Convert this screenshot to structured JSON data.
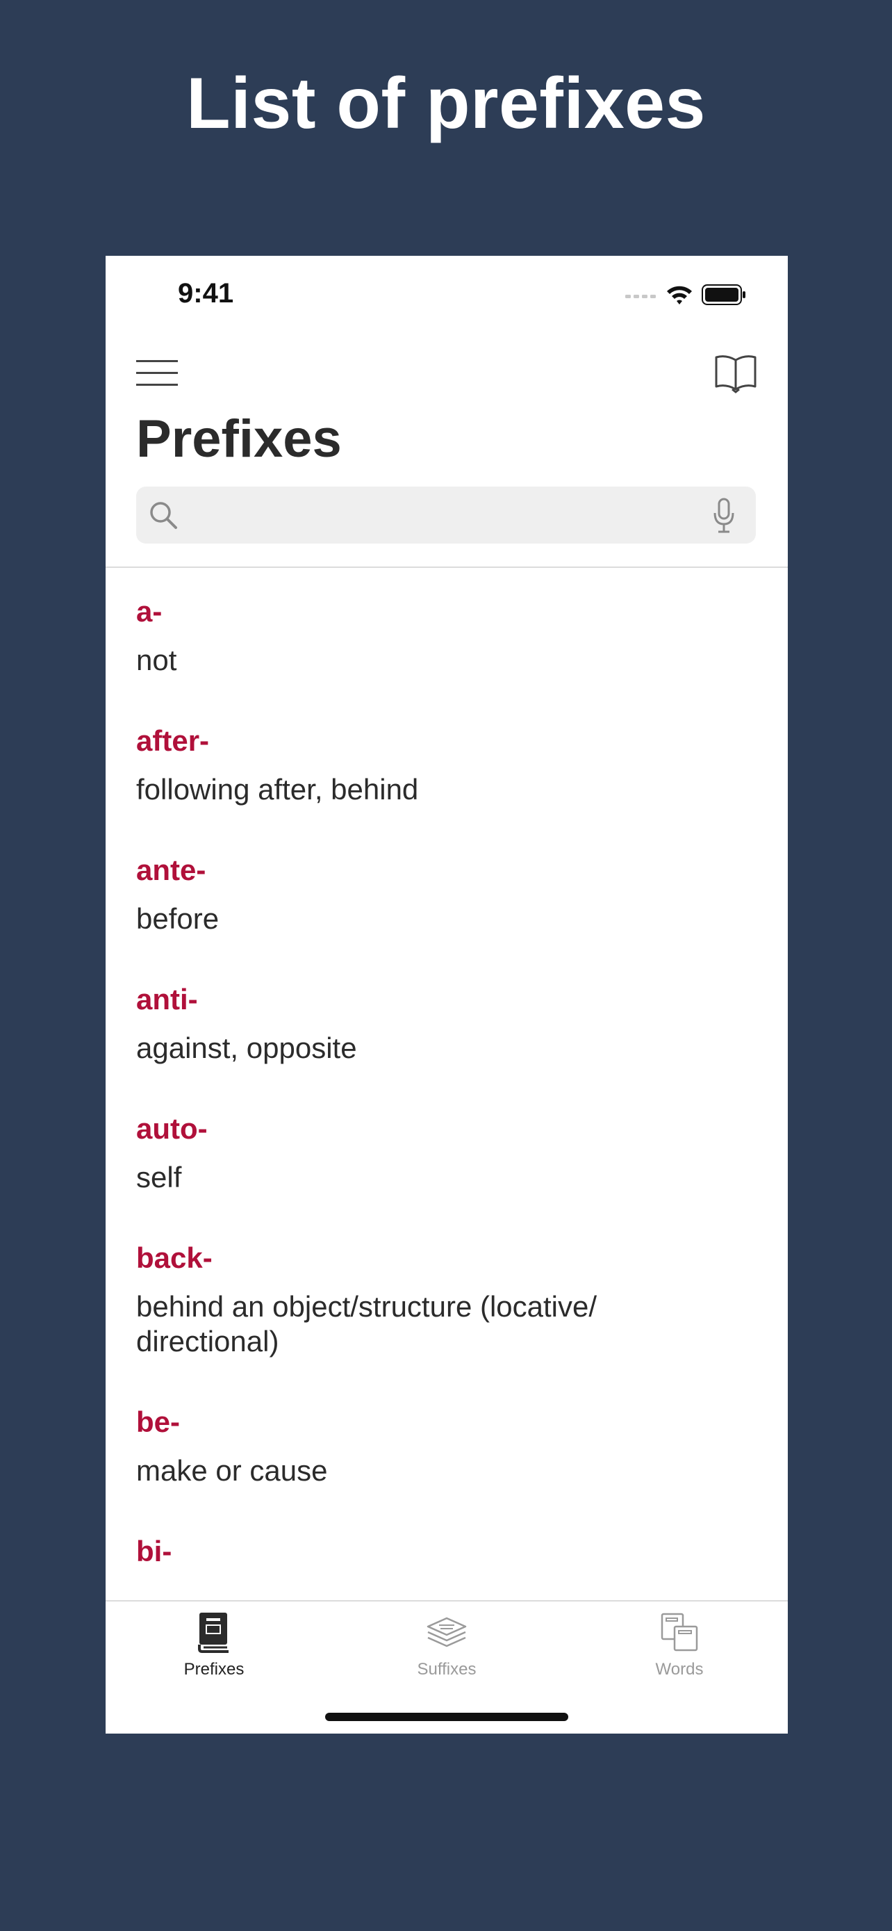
{
  "promo": {
    "title": "List of prefixes"
  },
  "status_bar": {
    "time": "9:41",
    "signal_icon": "cellular-signal-icon",
    "wifi_icon": "wifi-icon",
    "battery_icon": "battery-icon"
  },
  "header": {
    "menu_icon": "hamburger-menu-icon",
    "book_icon": "open-book-icon",
    "title": "Prefixes"
  },
  "search": {
    "placeholder": "",
    "value": "",
    "search_icon": "magnifier-icon",
    "mic_icon": "microphone-icon"
  },
  "list": {
    "items": [
      {
        "prefix": "a-",
        "meaning": "not"
      },
      {
        "prefix": "after-",
        "meaning": "following after, behind"
      },
      {
        "prefix": "ante-",
        "meaning": "before"
      },
      {
        "prefix": "anti-",
        "meaning": "against, opposite"
      },
      {
        "prefix": "auto-",
        "meaning": "self"
      },
      {
        "prefix": "back-",
        "meaning": "behind an object/structure (locative/ directional)"
      },
      {
        "prefix": "be-",
        "meaning": "make or cause"
      },
      {
        "prefix": "bi-",
        "meaning": ""
      }
    ]
  },
  "tab_bar": {
    "tabs": [
      {
        "label": "Prefixes",
        "icon": "book-stack-icon",
        "active": true
      },
      {
        "label": "Suffixes",
        "icon": "layers-icon",
        "active": false
      },
      {
        "label": "Words",
        "icon": "cards-icon",
        "active": false
      }
    ]
  },
  "colors": {
    "background": "#2d3d56",
    "accent": "#b0103a",
    "text": "#2b2b2b",
    "inactive": "#9a9a9a"
  }
}
